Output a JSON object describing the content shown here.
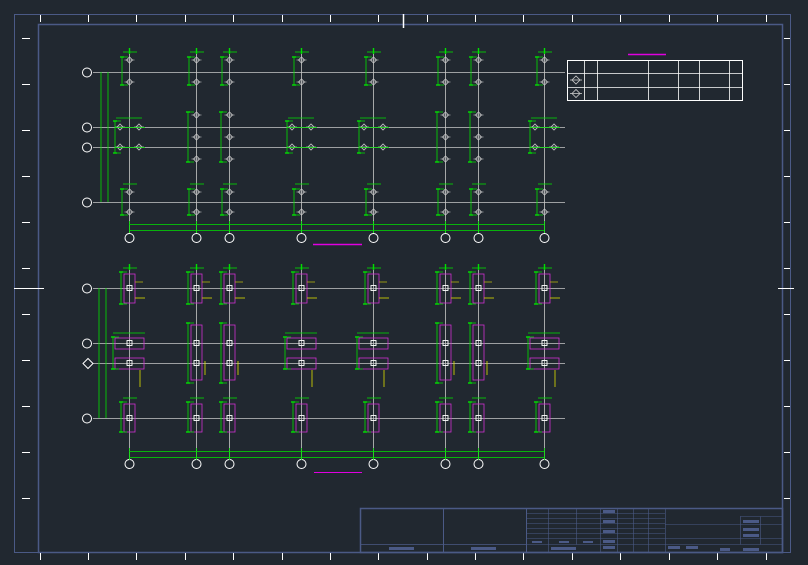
{
  "viewport": {
    "width": 808,
    "height": 565
  },
  "colors": {
    "background": "#212830",
    "border": "#4b5a86",
    "grid_axis": "#c8c8c8",
    "bubble": "#ffffff",
    "dimension": "#00e000",
    "rebar": "#d030d0",
    "note": "#e0e000",
    "title_accent": "#e000e0",
    "ticks": "#ffffff"
  },
  "drawing": {
    "sheet_name": "",
    "plan_upper": {
      "title": ""
    },
    "plan_lower": {
      "title": ""
    }
  },
  "legend_table": {
    "rows": 3,
    "cols": 7,
    "entries": []
  },
  "title_block": {
    "cells": []
  }
}
